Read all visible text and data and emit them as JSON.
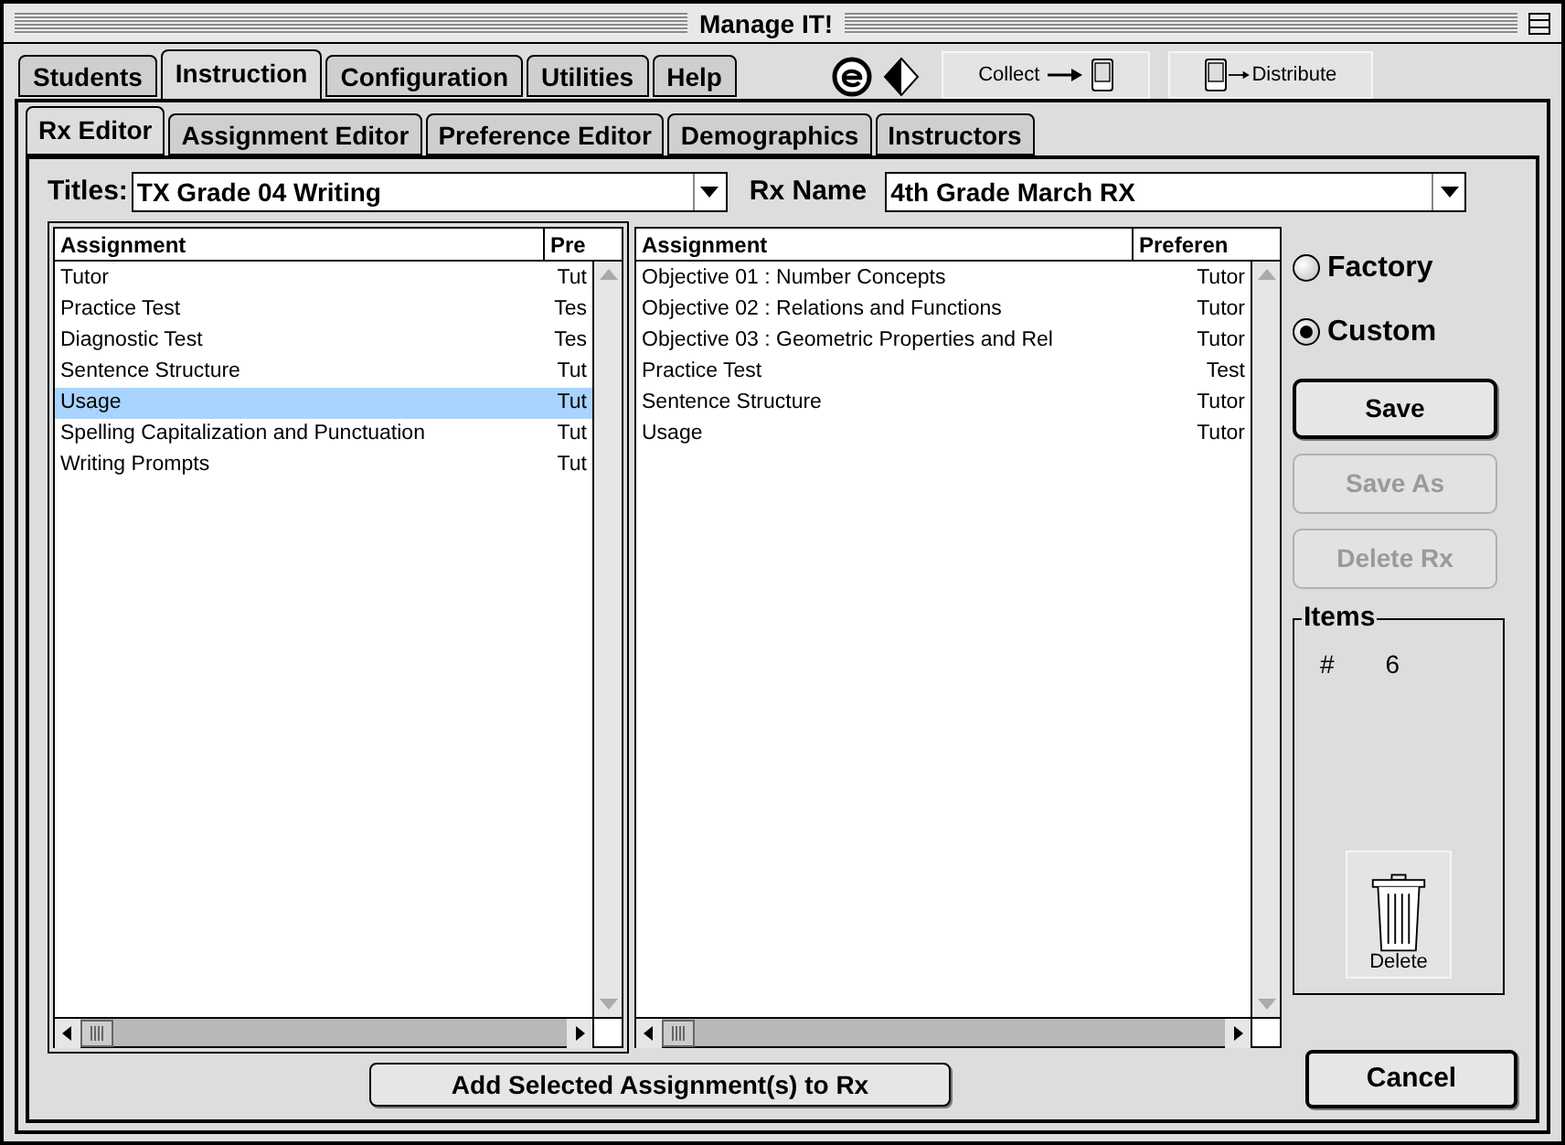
{
  "window": {
    "title": "Manage IT!"
  },
  "tabs": [
    {
      "label": "Students",
      "selected": false
    },
    {
      "label": "Instruction",
      "selected": true
    },
    {
      "label": "Configuration",
      "selected": false
    },
    {
      "label": "Utilities",
      "selected": false
    },
    {
      "label": "Help",
      "selected": false
    }
  ],
  "toolbar": {
    "collect": "Collect",
    "distribute": "Distribute"
  },
  "subtabs": [
    {
      "label": "Rx Editor",
      "selected": true
    },
    {
      "label": "Assignment Editor",
      "selected": false
    },
    {
      "label": "Preference Editor",
      "selected": false
    },
    {
      "label": "Demographics",
      "selected": false
    },
    {
      "label": "Instructors",
      "selected": false
    }
  ],
  "titles": {
    "label": "Titles:",
    "value": "TX Grade 04 Writing"
  },
  "rx_name": {
    "label": "Rx Name",
    "value": "4th Grade March RX"
  },
  "left_list": {
    "columns": [
      "Assignment",
      "Pre"
    ],
    "rows": [
      {
        "assignment": "Tutor",
        "preference": "Tut",
        "selected": false
      },
      {
        "assignment": "Practice Test",
        "preference": "Tes",
        "selected": false
      },
      {
        "assignment": "Diagnostic Test",
        "preference": "Tes",
        "selected": false
      },
      {
        "assignment": "Sentence Structure",
        "preference": "Tut",
        "selected": false
      },
      {
        "assignment": "Usage",
        "preference": "Tut",
        "selected": true
      },
      {
        "assignment": "Spelling Capitalization and Punctuation",
        "preference": "Tut",
        "selected": false
      },
      {
        "assignment": "Writing Prompts",
        "preference": "Tut",
        "selected": false
      }
    ]
  },
  "right_list": {
    "columns": [
      "Assignment",
      "Preferen"
    ],
    "rows": [
      {
        "assignment": "Objective 01 : Number Concepts",
        "preference": "Tutor",
        "selected": false
      },
      {
        "assignment": "Objective 02 : Relations and Functions",
        "preference": "Tutor",
        "selected": false
      },
      {
        "assignment": "Objective 03 : Geometric Properties and Rel",
        "preference": "Tutor",
        "selected": false
      },
      {
        "assignment": "Practice Test",
        "preference": "Test",
        "selected": false
      },
      {
        "assignment": "Sentence Structure",
        "preference": "Tutor",
        "selected": false
      },
      {
        "assignment": "Usage",
        "preference": "Tutor",
        "selected": false
      }
    ]
  },
  "radios": [
    {
      "label": "Factory",
      "selected": false
    },
    {
      "label": "Custom",
      "selected": true
    }
  ],
  "buttons": [
    {
      "label": "Save",
      "disabled": false
    },
    {
      "label": "Save As",
      "disabled": true
    },
    {
      "label": "Delete Rx",
      "disabled": true
    }
  ],
  "items": {
    "title": "Items",
    "hash": "#",
    "count": "6",
    "delete": "Delete"
  },
  "add_button": "Add Selected Assignment(s) to Rx",
  "cancel_button": "Cancel"
}
